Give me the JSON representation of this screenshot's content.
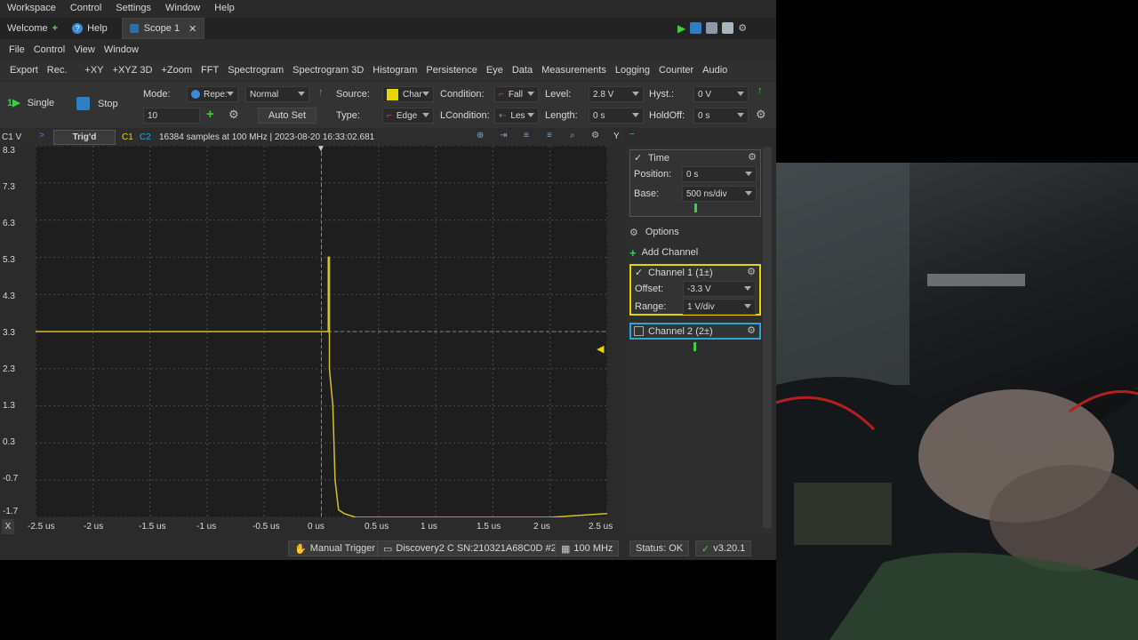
{
  "menubar": [
    "Workspace",
    "Control",
    "Settings",
    "Window",
    "Help"
  ],
  "tabs": {
    "welcome": "Welcome",
    "help": "Help",
    "scope": "Scope 1"
  },
  "submenu": [
    "File",
    "Control",
    "View",
    "Window"
  ],
  "toolmenu": [
    "Export",
    "Rec.",
    "+XY",
    "+XYZ 3D",
    "+Zoom",
    "FFT",
    "Spectrogram",
    "Spectrogram 3D",
    "Histogram",
    "Persistence",
    "Eye",
    "Data",
    "Measurements",
    "Logging",
    "Counter",
    "Audio"
  ],
  "toolbar": {
    "single": "Single",
    "stop": "Stop",
    "count": "10",
    "mode_label": "Mode:",
    "mode_value": "Repe:",
    "mode_type": "Normal",
    "autoset": "Auto Set",
    "source_label": "Source:",
    "source_value": "Char",
    "type_label": "Type:",
    "type_value": "Edge",
    "condition_label": "Condition:",
    "condition_value": "Fall",
    "lcondition_label": "LCondition:",
    "lcondition_value": "Les",
    "level_label": "Level:",
    "level_value": "2.8 V",
    "length_label": "Length:",
    "length_value": "0 s",
    "hyst_label": "Hyst.:",
    "hyst_value": "0 V",
    "holdoff_label": "HoldOff:",
    "holdoff_value": "0 s"
  },
  "plotbar": {
    "ch": "C1 V",
    "trig": "Trig'd",
    "c1": "C1",
    "c2": "C2",
    "info": "16384 samples at 100 MHz | 2023-08-20 16:33:02.681",
    "y": "Y"
  },
  "y_ticks": [
    "8.3",
    "7.3",
    "6.3",
    "5.3",
    "4.3",
    "3.3",
    "2.3",
    "1.3",
    "0.3",
    "-0.7",
    "-1.7"
  ],
  "x_ticks": [
    "-2.5 us",
    "-2 us",
    "-1.5 us",
    "-1 us",
    "-0.5 us",
    "0 us",
    "0.5 us",
    "1 us",
    "1.5 us",
    "2 us",
    "2.5 us"
  ],
  "x_close": "X",
  "side": {
    "time_title": "Time",
    "position_label": "Position:",
    "position_value": "0 s",
    "base_label": "Base:",
    "base_value": "500 ns/div",
    "options": "Options",
    "add_channel": "Add Channel",
    "ch1_title": "Channel 1 (1±)",
    "offset_label": "Offset:",
    "offset_value": "-3.3 V",
    "range_label": "Range:",
    "range_value": "1 V/div",
    "ch2_title": "Channel 2 (2±)"
  },
  "status": {
    "trigger": "Manual Trigger",
    "device": "Discovery2 C SN:210321A68C0D #2",
    "rate": "100 MHz",
    "status": "Status: OK",
    "version": "v3.20.1"
  },
  "colors": {
    "trace": "#d4c02a",
    "ch1": "#e8d400",
    "ch2": "#2aa7d8",
    "background": "#1e1e1e"
  },
  "chart_data": {
    "type": "line",
    "xlabel": "",
    "ylabel": "",
    "xlim": [
      -2.5,
      2.5
    ],
    "ylim": [
      -1.7,
      8.3
    ],
    "series": [
      {
        "x": [
          -2.5,
          0.06,
          0.06,
          0.07,
          0.07,
          0.1,
          0.12,
          0.15,
          0.2,
          0.3,
          0.5,
          2.0,
          2.5
        ],
        "y": [
          3.3,
          3.3,
          5.3,
          5.3,
          2.3,
          1.3,
          -0.7,
          -1.5,
          -1.6,
          -1.7,
          -1.7,
          -1.7,
          -1.6
        ]
      }
    ]
  }
}
